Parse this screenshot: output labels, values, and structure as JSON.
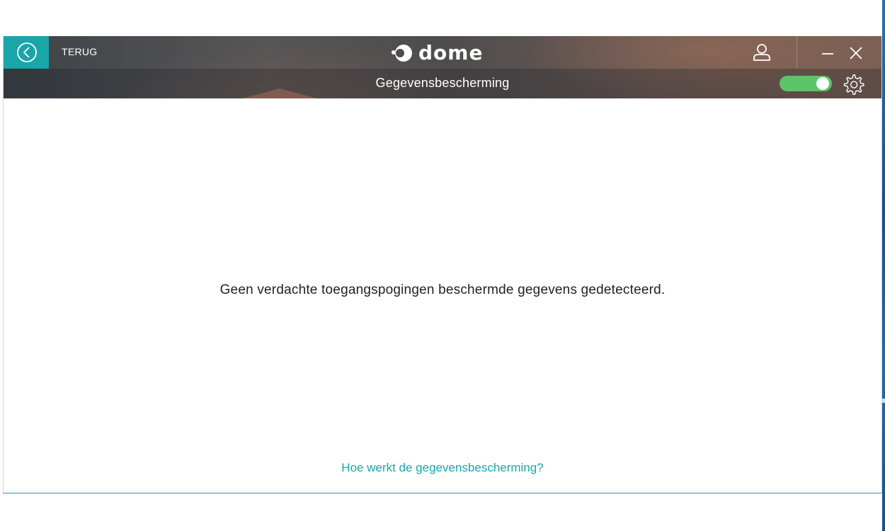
{
  "header": {
    "back_label": "TERUG",
    "logo_text": "dome",
    "subtitle": "Gegevensbescherming",
    "protection_toggle": {
      "on": true
    },
    "colors": {
      "accent": "#1aa5a8",
      "toggle_on": "#5ec468"
    }
  },
  "main": {
    "message": "Geen verdachte toegangspogingen beschermde gegevens gedetecteerd.",
    "help_link": "Hoe werkt de gegevensbescherming?"
  },
  "icons": [
    "back-arrow-icon",
    "logo-icon",
    "user-icon",
    "minimize-icon",
    "close-icon",
    "gear-icon"
  ]
}
